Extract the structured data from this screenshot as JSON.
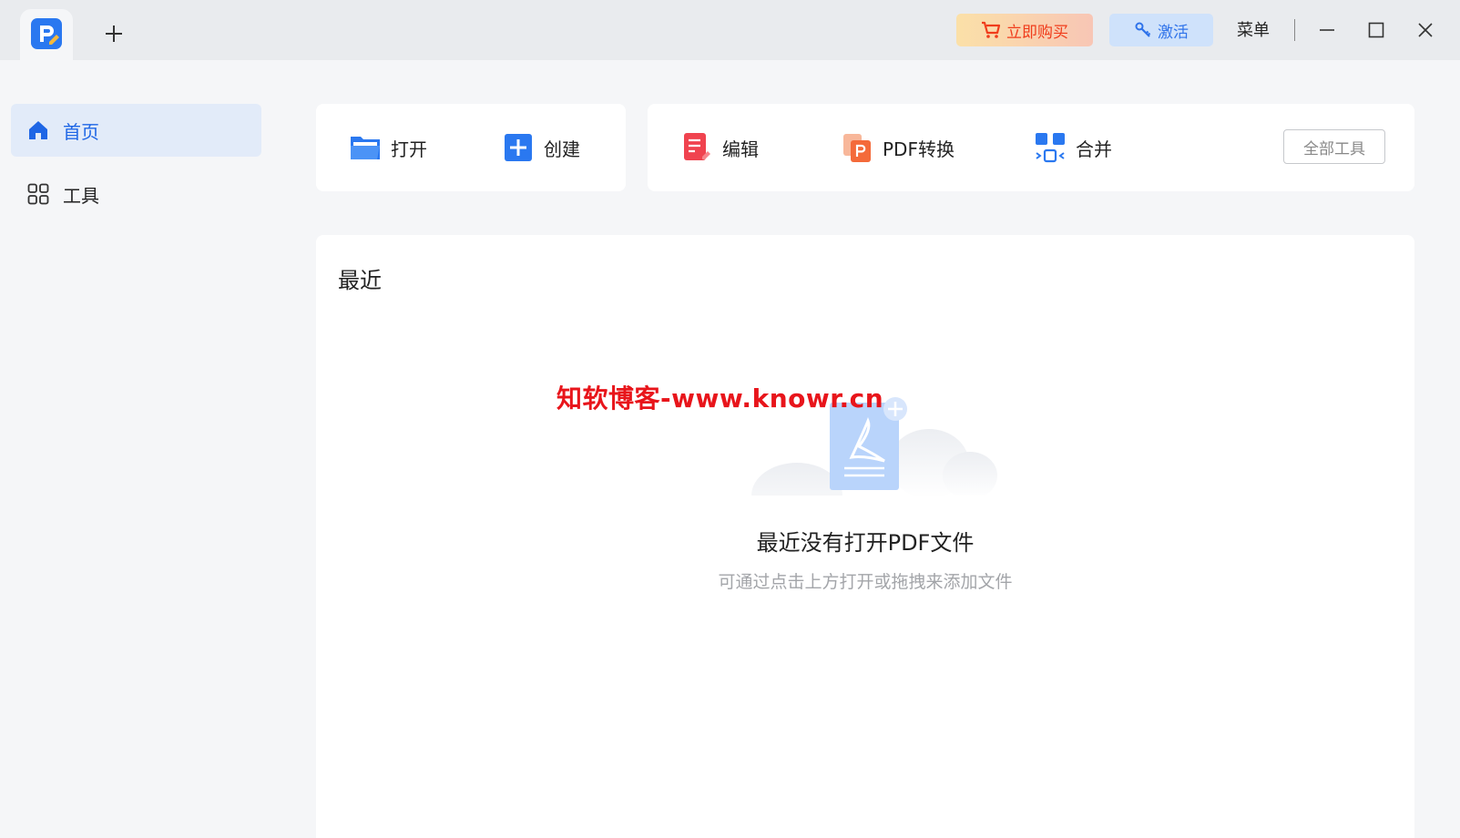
{
  "titlebar": {
    "buy_label": "立即购买",
    "activate_label": "激活",
    "menu_label": "菜单"
  },
  "sidebar": {
    "items": [
      {
        "label": "首页",
        "icon": "home-icon",
        "active": true
      },
      {
        "label": "工具",
        "icon": "grid-icon",
        "active": false
      }
    ]
  },
  "quick_actions": {
    "open_label": "打开",
    "create_label": "创建",
    "edit_label": "编辑",
    "convert_label": "PDF转换",
    "merge_label": "合并",
    "all_tools_label": "全部工具"
  },
  "recent": {
    "title": "最近",
    "empty_title": "最近没有打开PDF文件",
    "empty_hint": "可通过点击上方打开或拖拽来添加文件",
    "watermark": "知软博客-www.knowr.cn"
  },
  "colors": {
    "accent": "#1f66e5",
    "buy_text": "#f03c1b",
    "watermark": "#e8151b"
  }
}
